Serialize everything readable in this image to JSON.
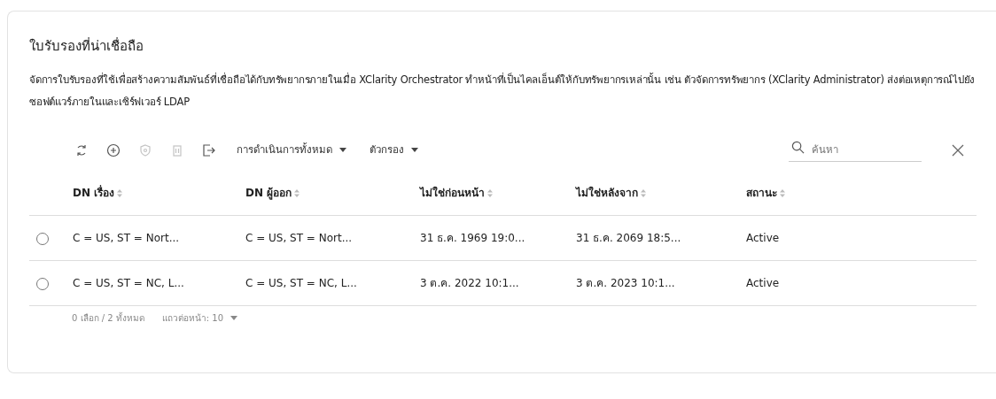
{
  "card": {
    "title": "ใบรับรองที่น่าเชื่อถือ",
    "description": "จัดการใบรับรองที่ใช้เพื่อสร้างความสัมพันธ์ที่เชื่อถือได้กับทรัพยากรภายในเมื่อ XClarity Orchestrator ทำหน้าที่เป็นไคลเอ็นต์ให้กับทรัพยากรเหล่านั้น เช่น ตัวจัดการทรัพยากร (XClarity Administrator) ส่งต่อเหตุการณ์ไปยังซอฟต์แวร์ภายในและเซิร์ฟเวอร์ LDAP"
  },
  "toolbar": {
    "tools": [
      {
        "kind": "refresh",
        "disabled": false
      },
      {
        "kind": "add",
        "disabled": false
      },
      {
        "kind": "shield",
        "disabled": true
      },
      {
        "kind": "delete",
        "disabled": true
      },
      {
        "kind": "export",
        "disabled": false
      }
    ],
    "menus": [
      "การดำเนินการทั้งหมด",
      "ตัวกรอง"
    ],
    "search": {
      "placeholder": "ค้นหา"
    }
  },
  "table": {
    "columns": [
      "DN เรื่อง",
      "DN ผู้ออก",
      "ไม่ใช่ก่อนหน้า",
      "ไม่ใช่หลังจาก",
      "สถานะ"
    ],
    "rows": [
      {
        "selected": false,
        "cells": [
          "C = US, ST = Nort...",
          "C = US, ST = Nort...",
          "31 ธ.ค. 1969 19:0...",
          "31 ธ.ค. 2069 18:5...",
          "Active"
        ]
      },
      {
        "selected": false,
        "cells": [
          "C = US, ST = NC, L...",
          "C = US, ST = NC, L...",
          "3 ต.ค. 2022 10:1...",
          "3 ต.ค. 2023 10:1...",
          "Active"
        ]
      }
    ]
  },
  "footer": {
    "selection": "0 เลือก / 2 ทั้งหมด",
    "rows_per_page": "แถวต่อหน้า: 10"
  }
}
